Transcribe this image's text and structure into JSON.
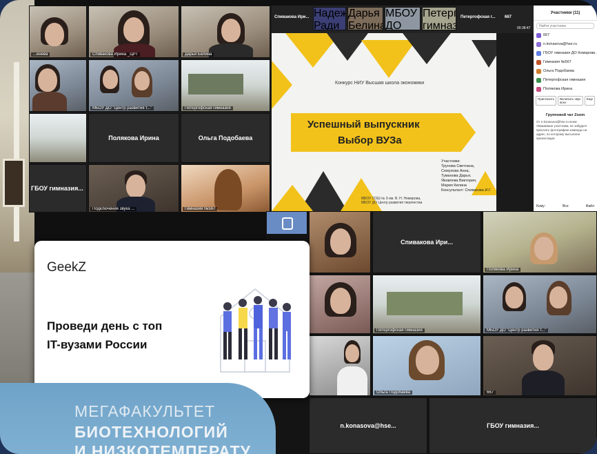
{
  "zoom1": {
    "tiles": [
      {
        "name": "...енева"
      },
      {
        "name": "Спивакова Ирина _ЦРТ"
      },
      {
        "name": "Дарья Белина"
      },
      {
        "name": "МБОУ ДО \"Центр развития т...\""
      },
      {
        "name": "Петергофская гимназия"
      },
      {
        "name": "Полякова Ирина"
      },
      {
        "name": "Ольга Подобаева"
      },
      {
        "name": "ГБОУ гимназия..."
      },
      {
        "name": "Подключение звука ..."
      },
      {
        "name": "Гимназия №567"
      }
    ],
    "topbar": {
      "speaker": "Спивакова Ири...",
      "p1": "Надежда Ради",
      "p2": "Дарья Белина",
      "p3": "МБОУ ДО Центр...",
      "p4": "Петергофская гимназия",
      "p5": "Петергофская г...",
      "count": "667",
      "time": "00:38:47"
    },
    "slide": {
      "contest": "Конкурс  НИУ Высшая школа экономики",
      "title_line1": "Успешный выпускник",
      "title_line2": "Выбор ВУЗа",
      "participants": [
        "Участники:",
        "Трунова Светлана,",
        "Семухова Анна,",
        "Туманова Дарья,",
        "Яковлева Виктория,",
        "Мария Килина",
        "Консультант: Спивакова И.Г."
      ],
      "school": "МБОУ СОШ № 9 им. В. Н. Немирова, МБОУ ДО Центр развития творчества"
    },
    "chat": {
      "header": "Участники (11)",
      "search_placeholder": "Найти участника",
      "participants": [
        {
          "name": "667",
          "color": "#7b5cd6"
        },
        {
          "name": "n.konasova@hse.ru",
          "color": "#8e6fd8"
        },
        {
          "name": "ГБОУ гимназия ДО Комарова ...",
          "color": "#5f7ee0"
        },
        {
          "name": "Гимназия №567",
          "color": "#c0542a"
        },
        {
          "name": "Ольга Подобаева",
          "color": "#d07d2b"
        },
        {
          "name": "Петергофская гимназия",
          "color": "#3b8f4e"
        },
        {
          "name": "Полякова Ирина",
          "color": "#c84c7f"
        }
      ],
      "btn_invite": "Пригласить",
      "btn_unmute": "Включить звук всех",
      "btn_more": "Еще",
      "group_title": "Групповой чат Zoom",
      "message": "От n.konasova@hse.ru всем: Уважаемые участники, не забудьте прислать фотографию команды на адрес, по которому высылали презентации",
      "to_label": "Кому:",
      "to_value": "Все",
      "file_label": "Файл"
    }
  },
  "zoom2": {
    "tiles": [
      {
        "name": ""
      },
      {
        "name": "Спивакова Ири..."
      },
      {
        "name": "Полякова Ирина"
      },
      {
        "name": ""
      },
      {
        "name": "Петергофская гимназия"
      },
      {
        "name": "МБОУ ДО \"Центр развития т...\""
      },
      {
        "name": ""
      },
      {
        "name": "Ольга Подобаева"
      },
      {
        "name": "667"
      },
      {
        "name": "n.konasova@hse..."
      },
      {
        "name": "ГБОУ гимназия..."
      }
    ]
  },
  "geekz": {
    "logo": "GeekZ",
    "line1": "Проведи день с топ",
    "line2": "IT-вузами России"
  },
  "mega": {
    "line1": "МЕГАФАКУЛЬТЕТ",
    "line2": "БИОТЕХНОЛОГИЙ",
    "line3": "И НИЗКОТЕМПЕРАТУ"
  },
  "colors": {
    "accent_yellow": "#f2c21b",
    "mega_blue": "#7fb0d2",
    "frame_blue": "#1f3358"
  }
}
